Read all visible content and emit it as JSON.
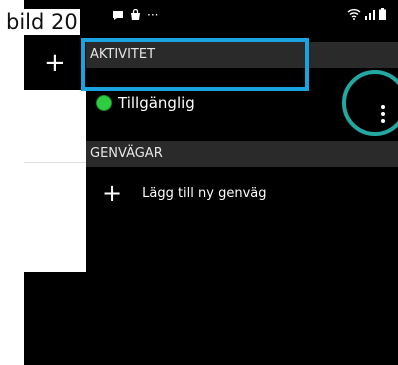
{
  "annotation": {
    "label": "bild 20",
    "rect_color": "#1aa3e0",
    "circle_color": "#22a8a0"
  },
  "status_bar": {
    "icons": [
      "chat-bubble-icon",
      "bag-icon",
      "more-dots-icon",
      "wifi-icon",
      "signal-icon",
      "battery-icon"
    ],
    "overflow": "···"
  },
  "background_app": {
    "add_symbol": "+"
  },
  "drawer": {
    "activity_header": "AKTIVITET",
    "status_label": "Tillgänglig",
    "status_color": "#2ecc40",
    "more_icon": "vertical-dots-icon",
    "shortcuts_header": "GENVÄGAR",
    "add_symbol": "+",
    "add_shortcut_label": "Lägg till ny genväg"
  }
}
